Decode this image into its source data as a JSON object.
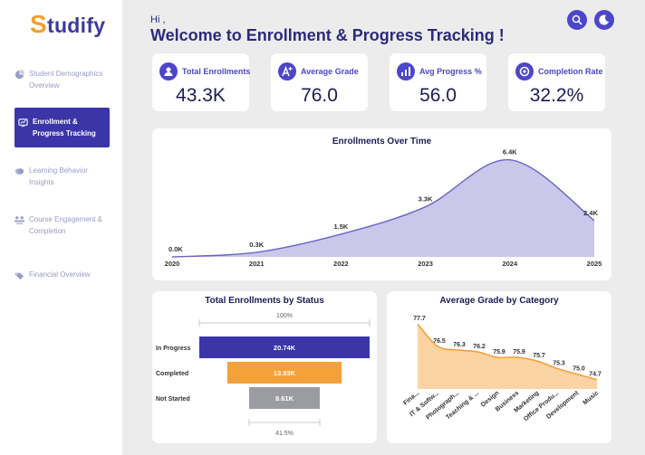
{
  "app": {
    "logo_initial": "S",
    "logo_rest": "tudify"
  },
  "sidebar": {
    "items": [
      {
        "label": "Student Demographics Overview",
        "icon": "pie-chart-icon",
        "active": false
      },
      {
        "label": "Enrollment & Progress Tracking",
        "icon": "progress-icon",
        "active": true
      },
      {
        "label": "Learning Behavior Insights",
        "icon": "brain-icon",
        "active": false
      },
      {
        "label": "Course Engagement & Completion",
        "icon": "engagement-icon",
        "active": false
      },
      {
        "label": "Financial Overview",
        "icon": "finance-icon",
        "active": false
      }
    ]
  },
  "header": {
    "greeting": "Hi ,",
    "title": "Welcome to Enrollment & Progress Tracking !"
  },
  "top_buttons": [
    {
      "icon": "search-icon"
    },
    {
      "icon": "moon-icon"
    }
  ],
  "kpis": [
    {
      "label": "Total Enrollments",
      "value": "43.3K",
      "icon": "users-icon"
    },
    {
      "label": "Average Grade",
      "value": "76.0",
      "icon": "grade-icon"
    },
    {
      "label": "Avg Progress %",
      "value": "56.0",
      "icon": "progress-chart-icon"
    },
    {
      "label": "Completion Rate",
      "value": "32.2%",
      "icon": "completion-icon"
    }
  ],
  "colors": {
    "accent": "#4d46c9",
    "navy": "#1e1c55",
    "area_fill": "#cac7ea",
    "orange": "#f5a13a",
    "orange_fill": "#fcd3a3",
    "grey_bar": "#9b9ba2"
  },
  "chart_data": [
    {
      "type": "area",
      "title": "Enrollments Over Time",
      "x": [
        "2020",
        "2021",
        "2022",
        "2023",
        "2024",
        "2025"
      ],
      "values": [
        0.0,
        0.3,
        1.5,
        3.3,
        6.4,
        2.4
      ],
      "labels": [
        "0.0K",
        "0.3K",
        "1.5K",
        "3.3K",
        "6.4K",
        "2.4K"
      ],
      "ylim": [
        0,
        6.8
      ]
    },
    {
      "type": "bar",
      "title": "Total Enrollments by Status",
      "categories": [
        "In Progress",
        "Completed",
        "Not Started"
      ],
      "values": [
        20.74,
        13.93,
        8.61
      ],
      "labels": [
        "20.74K",
        "13.93K",
        "8.61K"
      ],
      "top_label": "100%",
      "bottom_label": "41.5%"
    },
    {
      "type": "area",
      "title": "Average Grade by Category",
      "categories": [
        "Fina...",
        "IT & Softw...",
        "Photograph...",
        "Teaching & ...",
        "Design",
        "Business",
        "Marketing",
        "Office Produ...",
        "Development",
        "Music"
      ],
      "values": [
        77.7,
        76.5,
        76.3,
        76.2,
        75.9,
        75.9,
        75.7,
        75.3,
        75.0,
        74.7
      ],
      "labels": [
        "77.7",
        "76.5",
        "76.3",
        "76.2",
        "75.9",
        "75.9",
        "75.7",
        "75.3",
        "75.0",
        "74.7"
      ],
      "ylim": [
        74.2,
        77.9
      ]
    }
  ]
}
